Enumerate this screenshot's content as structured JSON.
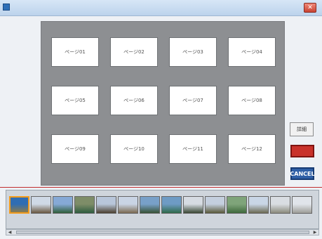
{
  "window": {
    "title": "",
    "close_glyph": "✕"
  },
  "panel": {
    "instruction_top": "",
    "instruction_bottom": "",
    "slots": [
      "ページ01",
      "ページ02",
      "ページ03",
      "ページ04",
      "ページ05",
      "ページ06",
      "ページ07",
      "ページ08",
      "ページ09",
      "ページ10",
      "ページ11",
      "ページ12"
    ]
  },
  "buttons": {
    "detail": "詳細",
    "ok": "",
    "cancel": "CANCEL"
  },
  "thumbnails": [
    {
      "head": "",
      "caption": "",
      "icon": "photo-thumbnail",
      "selected": true,
      "color_top": "#2f6db3",
      "color_bottom": "#8b7b4c"
    },
    {
      "head": "",
      "caption": "",
      "icon": "photo-thumbnail",
      "selected": false,
      "color_top": "#cfd9e6",
      "color_bottom": "#6a5841"
    },
    {
      "head": "",
      "caption": "",
      "icon": "photo-thumbnail",
      "selected": false,
      "color_top": "#86a9d6",
      "color_bottom": "#2f5e3a"
    },
    {
      "head": "",
      "caption": "",
      "icon": "photo-thumbnail",
      "selected": false,
      "color_top": "#7e8d68",
      "color_bottom": "#2e5c3f"
    },
    {
      "head": "",
      "caption": "",
      "icon": "photo-thumbnail",
      "selected": false,
      "color_top": "#b8c6da",
      "color_bottom": "#4c4030"
    },
    {
      "head": "",
      "caption": "",
      "icon": "photo-thumbnail",
      "selected": false,
      "color_top": "#c9d4e4",
      "color_bottom": "#7b6a51"
    },
    {
      "head": "",
      "caption": "",
      "icon": "photo-thumbnail",
      "selected": false,
      "color_top": "#78a0c8",
      "color_bottom": "#375235"
    },
    {
      "head": "",
      "caption": "",
      "icon": "photo-thumbnail",
      "selected": false,
      "color_top": "#6e9bc4",
      "color_bottom": "#2f6a4a"
    },
    {
      "head": "",
      "caption": "",
      "icon": "photo-thumbnail",
      "selected": false,
      "color_top": "#d6dbe2",
      "color_bottom": "#394734"
    },
    {
      "head": "",
      "caption": "",
      "icon": "photo-thumbnail",
      "selected": false,
      "color_top": "#c4cfde",
      "color_bottom": "#5a5a3b"
    },
    {
      "head": "",
      "caption": "",
      "icon": "photo-thumbnail",
      "selected": false,
      "color_top": "#7fa47a",
      "color_bottom": "#3f6a3d"
    },
    {
      "head": "",
      "caption": "",
      "icon": "photo-thumbnail",
      "selected": false,
      "color_top": "#c9d6e6",
      "color_bottom": "#6b6a53"
    },
    {
      "head": "",
      "caption": "",
      "icon": "photo-thumbnail",
      "selected": false,
      "color_top": "#d9dde2",
      "color_bottom": "#8a8a7c"
    },
    {
      "head": "",
      "caption": "",
      "icon": "photo-thumbnail",
      "selected": false,
      "color_top": "#e0e4ea",
      "color_bottom": "#9e9e98"
    }
  ],
  "scroll": {
    "left_glyph": "◀",
    "right_glyph": "▶"
  },
  "colors": {
    "ok": "#c9322b",
    "cancel": "#2f5fa6",
    "separator": "#c12e2e",
    "selected": "#f39c1d"
  }
}
